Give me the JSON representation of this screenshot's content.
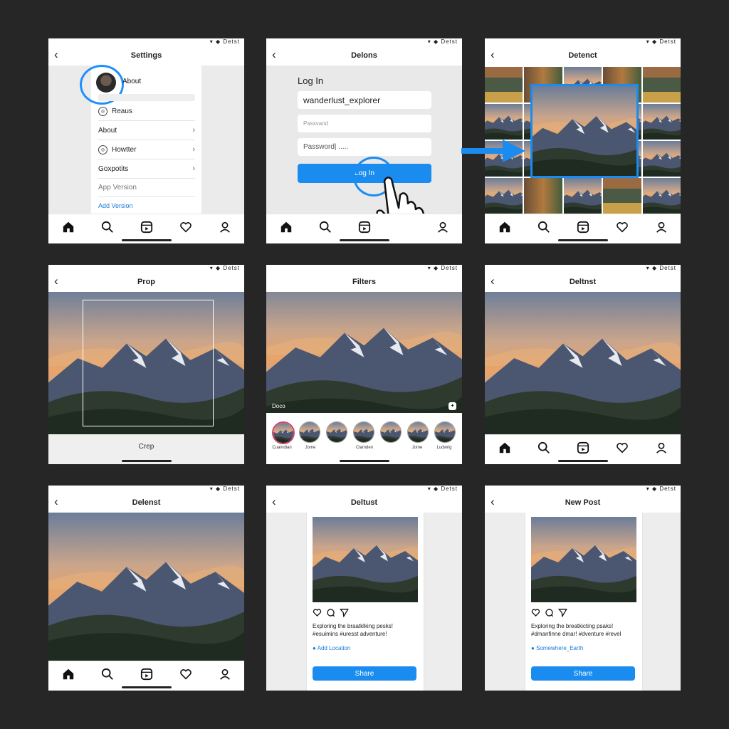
{
  "status_text": "▾ ◆ Detst",
  "settings": {
    "title": "Settings",
    "profile_label": "About",
    "rows": [
      "Reaus",
      "About",
      "Howtter",
      "Goxpotits",
      "App Version",
      "Add Version"
    ]
  },
  "login": {
    "title": "Delons",
    "heading": "Log In",
    "username_value": "wanderlust_explorer",
    "password_placeholder": "Passvand",
    "password_value": "Password| .....",
    "button_label": "Log In"
  },
  "gallery": {
    "title": "Detenct"
  },
  "crop": {
    "title": "Prop",
    "button_label": "Crep"
  },
  "filters": {
    "title": "Filters",
    "overlay_label": "Doco",
    "names": [
      "Cuamdian",
      "Jome",
      "Clamden",
      "Jome",
      "Ludwrig"
    ]
  },
  "preview": {
    "title": "Deltnst"
  },
  "preview2": {
    "title": "Delenst"
  },
  "compose": {
    "title": "Deltust",
    "caption": "Exploring the braatklking pesks! #esuimins #uresst adventure!",
    "location": "Add Location",
    "share": "Share"
  },
  "newpost": {
    "title": "New Post",
    "caption": "Exploring the breatkicting psaks! #dmanfinne dmar! #dventure #revel",
    "location": "Somewhere_Earth",
    "share": "Share"
  },
  "colors": {
    "accent": "#1a8cf0",
    "background": "#262626"
  },
  "icons": [
    "back-icon",
    "home-icon",
    "search-icon",
    "reels-icon",
    "heart-icon",
    "profile-icon",
    "pointer-hand-icon",
    "arrow-right-icon",
    "comment-icon",
    "send-icon",
    "location-pin-icon"
  ]
}
